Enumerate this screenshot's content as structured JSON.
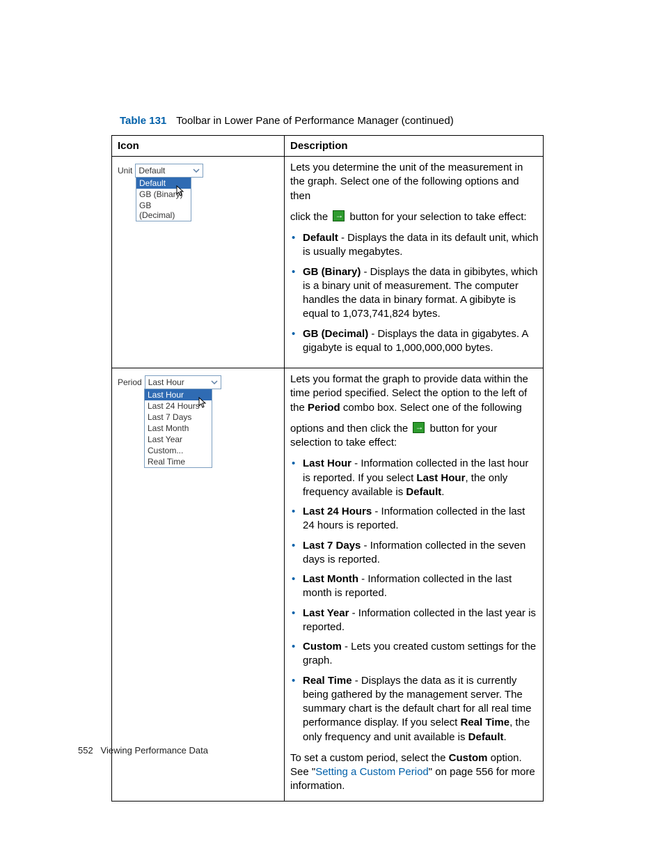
{
  "caption": {
    "label": "Table 131",
    "text": "Toolbar in Lower Pane of Performance Manager (continued)"
  },
  "headers": {
    "icon": "Icon",
    "desc": "Description"
  },
  "row1": {
    "combo_label": "Unit",
    "combo_value": "Default",
    "options": {
      "sel": "Default",
      "o1": "GB (Binary)",
      "o2": "GB (Decimal)"
    },
    "intro1": "Lets you determine the unit of the measurement in the graph. Select one of the following options and then",
    "intro2a": "click the ",
    "intro2b": " button for your selection to take effect:",
    "b1_term": "Default",
    "b1_rest": " - Displays the data in its default unit, which is usually megabytes.",
    "b2_term": "GB (Binary)",
    "b2_rest": " - Displays the data in gibibytes, which is a binary unit of measurement. The computer handles the data in binary format. A gibibyte is equal to 1,073,741,824 bytes.",
    "b3_term": "GB (Decimal)",
    "b3_rest": " - Displays the data in gigabytes. A gigabyte is equal to 1,000,000,000 bytes."
  },
  "row2": {
    "combo_label": "Period",
    "combo_value": "Last Hour",
    "options": {
      "sel": "Last Hour",
      "o1": "Last 24 Hours",
      "o2": "Last 7 Days",
      "o3": "Last Month",
      "o4": "Last Year",
      "o5": "Custom...",
      "o6": "Real Time"
    },
    "intro1a": "Lets you format the graph to provide data within the time period specified. Select the option to the left of the ",
    "intro1_term": "Period",
    "intro1b": " combo box. Select one of the following",
    "intro2a": "options and then click the ",
    "intro2b": " button for your selection to take effect:",
    "b1_term": "Last Hour",
    "b1_mid1": " - Information collected in the last hour is reported. If you select ",
    "b1_term2": "Last Hour",
    "b1_mid2": ", the only frequency available is ",
    "b1_term3": "Default",
    "b1_end": ".",
    "b2_term": "Last 24 Hours",
    "b2_rest": " - Information collected in the last 24 hours is reported.",
    "b3_term": "Last 7 Days",
    "b3_rest": " - Information collected in the seven days is reported.",
    "b4_term": "Last Month",
    "b4_rest": " - Information collected in the last month is reported.",
    "b5_term": "Last Year",
    "b5_rest": " - Information collected in the last year is reported.",
    "b6_term": "Custom",
    "b6_rest": " - Lets you created custom settings for the graph.",
    "b7_term": "Real Time",
    "b7_mid1": " - Displays the data as it is currently being gathered by the management server. The summary chart is the default chart for all real time performance display. If you select ",
    "b7_term2": "Real Time",
    "b7_mid2": ", the only frequency and unit available is ",
    "b7_term3": "Default",
    "b7_end": ".",
    "out_a": "To set a custom period, select the ",
    "out_term": "Custom",
    "out_b": " option. See \"",
    "out_link": "Setting a Custom Period",
    "out_c": "\" on page 556 for more information."
  },
  "footer": {
    "page": "552",
    "title": "Viewing Performance Data"
  }
}
